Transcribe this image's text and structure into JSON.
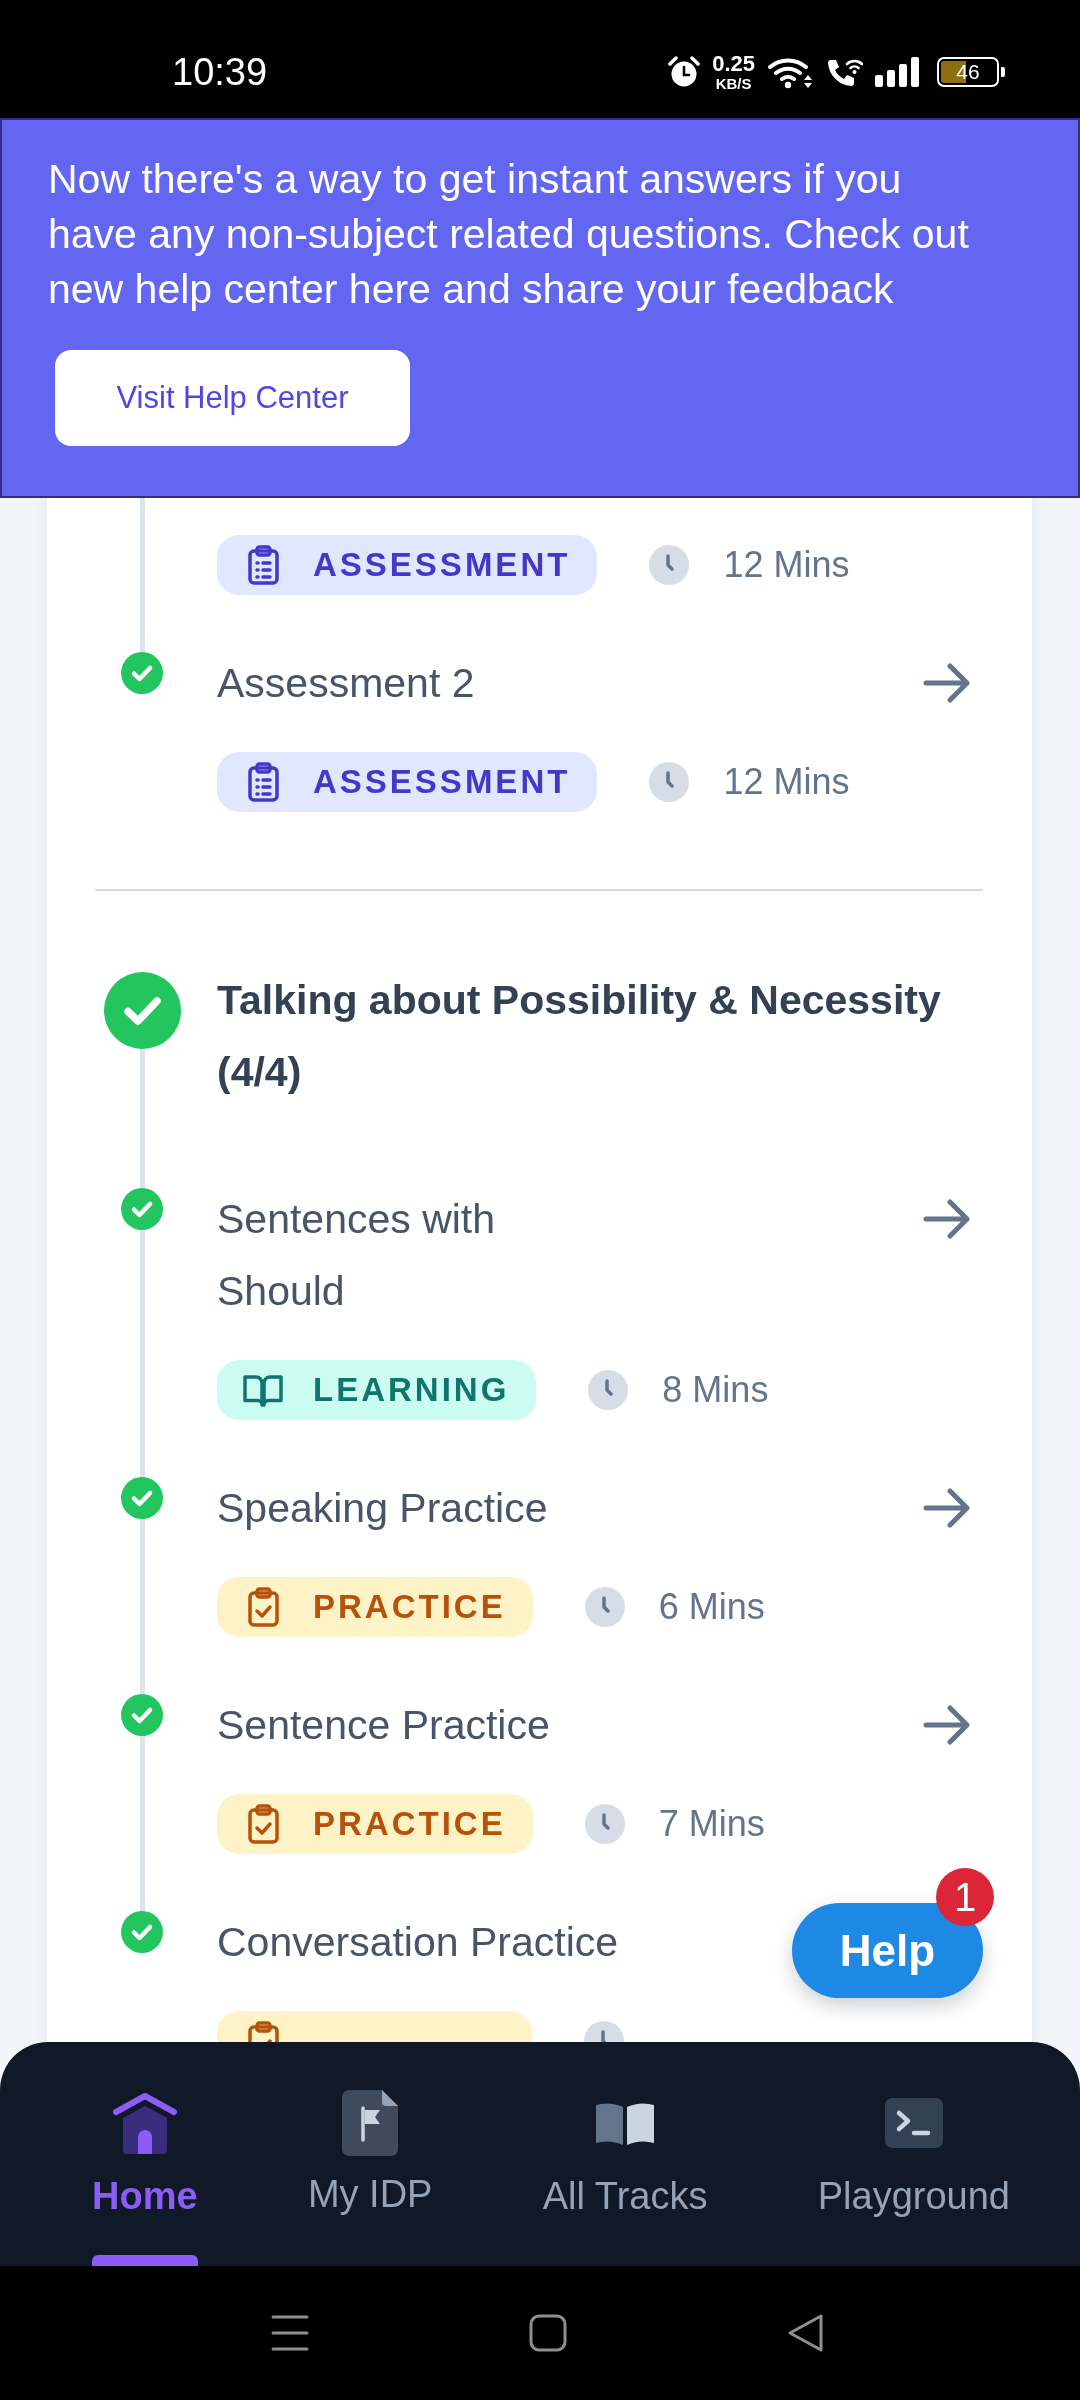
{
  "status_bar": {
    "time": "10:39",
    "speed_value": "0.25",
    "speed_unit": "KB/S",
    "battery": "46"
  },
  "banner": {
    "message": "Now there's a way to get instant answers if you have any non-subject related questions. Check out new help center here and share your feedback",
    "button": "Visit Help Center"
  },
  "sections": [
    {
      "items": [
        {
          "tag": {
            "kind": "assessment",
            "label": "ASSESSMENT"
          },
          "duration": "12 Mins"
        },
        {
          "title": "Assessment 2",
          "completed": true,
          "arrow": true,
          "tag": {
            "kind": "assessment",
            "label": "ASSESSMENT"
          },
          "duration": "12 Mins"
        }
      ]
    },
    {
      "title": "Talking about Possibility & Necessity (4/4)",
      "completed": true,
      "items": [
        {
          "title": "Sentences with Should",
          "completed": true,
          "arrow": true,
          "tag": {
            "kind": "learning",
            "label": "LEARNING"
          },
          "duration": "8 Mins"
        },
        {
          "title": "Speaking Practice",
          "completed": true,
          "arrow": true,
          "tag": {
            "kind": "practice",
            "label": "PRACTICE"
          },
          "duration": "6 Mins"
        },
        {
          "title": "Sentence Practice",
          "completed": true,
          "arrow": true,
          "tag": {
            "kind": "practice",
            "label": "PRACTICE"
          },
          "duration": "7 Mins"
        },
        {
          "title": "Conversation Practice",
          "completed": true,
          "arrow": false,
          "tag": {
            "kind": "practice"
          }
        }
      ]
    }
  ],
  "help_button": {
    "label": "Help",
    "badge": "1"
  },
  "bottom_nav": [
    {
      "label": "Home",
      "selected": true
    },
    {
      "label": "My IDP",
      "selected": false
    },
    {
      "label": "All Tracks",
      "selected": false
    },
    {
      "label": "Playground",
      "selected": false
    }
  ]
}
